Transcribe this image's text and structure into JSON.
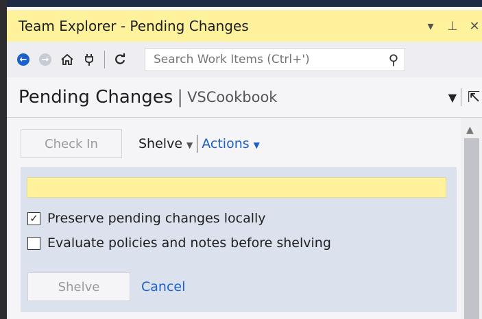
{
  "window": {
    "title": "Team Explorer - Pending Changes",
    "title_icons": [
      "dropdown-arrow-icon",
      "pin-icon",
      "close-icon"
    ]
  },
  "toolbar": {
    "back_icon": "back-arrow-icon",
    "forward_icon": "forward-arrow-icon",
    "home_icon": "home-icon",
    "connect_icon": "plug-icon",
    "refresh_icon": "refresh-icon",
    "search_placeholder": "Search Work Items (Ctrl+')",
    "search_icon": "search-icon"
  },
  "header": {
    "title": "Pending Changes",
    "separator": "|",
    "subtitle": "VSCookbook"
  },
  "actions": {
    "check_in_label": "Check In",
    "shelve_label": "Shelve",
    "actions_label": "Actions"
  },
  "shelve_panel": {
    "name_value": "",
    "preserve_label": "Preserve pending changes locally",
    "preserve_checked": true,
    "evaluate_label": "Evaluate policies and notes before shelving",
    "evaluate_checked": false,
    "shelve_button_label": "Shelve",
    "cancel_label": "Cancel"
  },
  "colors": {
    "titlebar_bg": "#fff29d",
    "accent_blue": "#1c61c9",
    "panel_bg": "#dce1ee"
  }
}
